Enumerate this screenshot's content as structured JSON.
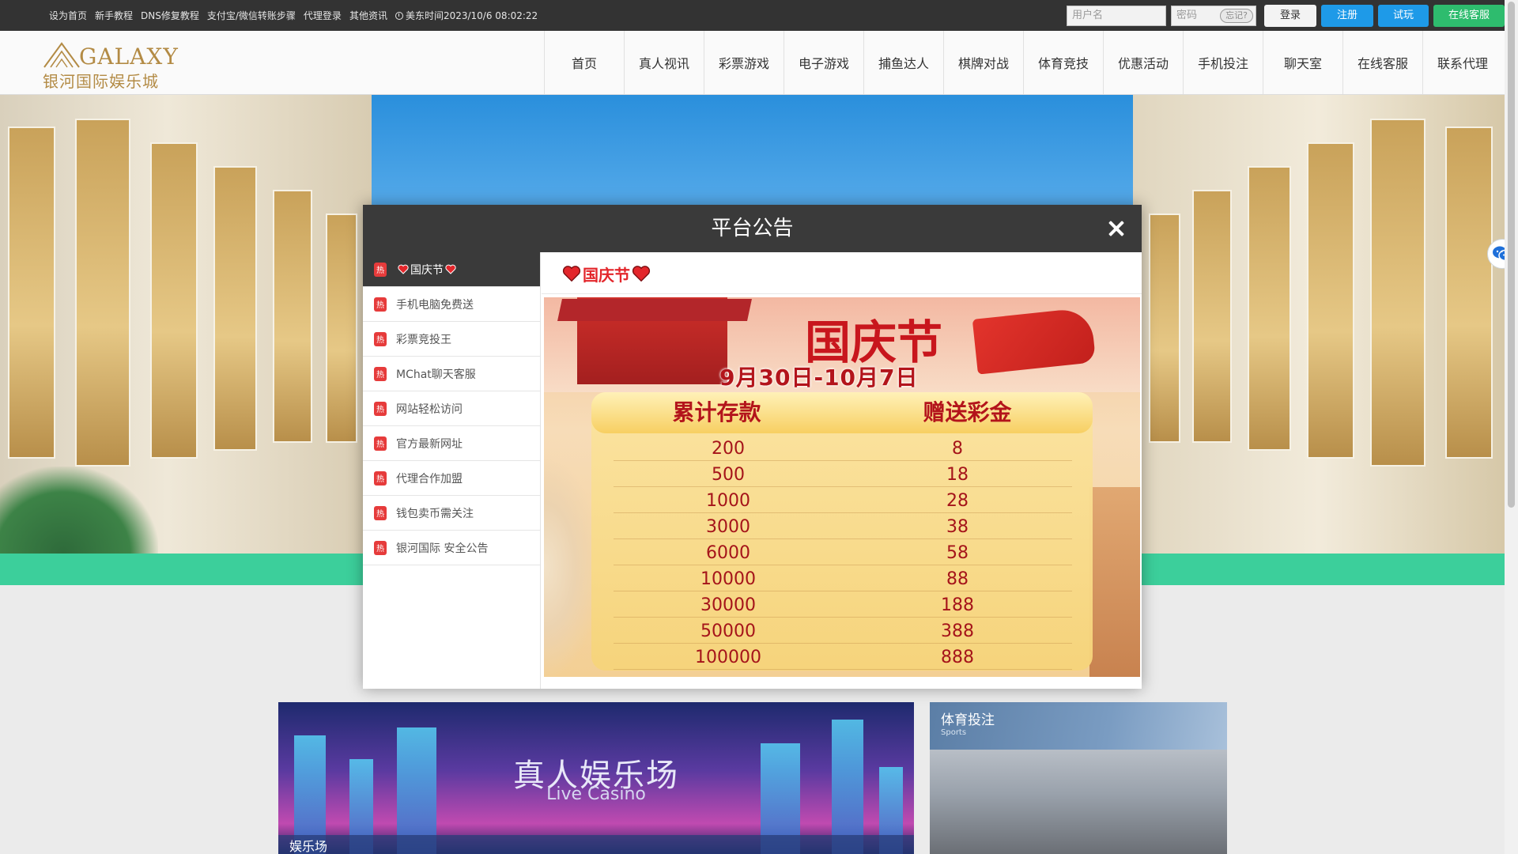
{
  "topbar": {
    "links": [
      "设为首页",
      "新手教程",
      "DNS修复教程",
      "支付宝/微信转账步骤",
      "代理登录",
      "其他资讯"
    ],
    "clock_text": "美东时间2023/10/6 08:02:22",
    "username_placeholder": "用户名",
    "password_placeholder": "密码",
    "forgot_label": "忘记?",
    "login_label": "登录",
    "register_label": "注册",
    "trial_label": "试玩",
    "service_label": "在线客服"
  },
  "header": {
    "logo_en": "GALAXY",
    "logo_cn": "银河国际娱乐城",
    "nav": [
      "首页",
      "真人视讯",
      "彩票游戏",
      "电子游戏",
      "捕鱼达人",
      "棋牌对战",
      "体育竞技",
      "优惠活动",
      "手机投注",
      "聊天室",
      "在线客服",
      "联系代理"
    ]
  },
  "modal": {
    "title": "平台公告",
    "hot_badge": "热",
    "list": [
      {
        "label": "国庆节",
        "active": true
      },
      {
        "label": "手机电脑免费送",
        "active": false
      },
      {
        "label": "彩票竞投王",
        "active": false
      },
      {
        "label": "MChat聊天客服",
        "active": false
      },
      {
        "label": "网站轻松访问",
        "active": false
      },
      {
        "label": "官方最新网址",
        "active": false
      },
      {
        "label": "代理合作加盟",
        "active": false
      },
      {
        "label": "钱包卖币需关注",
        "active": false
      },
      {
        "label": "银河国际 安全公告",
        "active": false
      }
    ],
    "content_title": "国庆节",
    "poster": {
      "brand": "国庆节",
      "dates": "9月30日-10月7日",
      "col1": "累计存款",
      "col2": "赠送彩金",
      "rows": [
        [
          "200",
          "8"
        ],
        [
          "500",
          "18"
        ],
        [
          "1000",
          "28"
        ],
        [
          "3000",
          "38"
        ],
        [
          "6000",
          "58"
        ],
        [
          "10000",
          "88"
        ],
        [
          "30000",
          "188"
        ],
        [
          "50000",
          "388"
        ],
        [
          "100000",
          "888"
        ]
      ]
    }
  },
  "sections": {
    "casino_title": "真人娱乐场",
    "casino_sub": "Live Casino",
    "casino_foot": "娱乐场",
    "sports_title": "体育投注",
    "sports_sub": "Sports"
  },
  "colors": {
    "topbar": "#333333",
    "register": "#1e9ae8",
    "service": "#2ebc6e",
    "accent_red": "#e3262b",
    "green_band": "#3ccf9b"
  }
}
